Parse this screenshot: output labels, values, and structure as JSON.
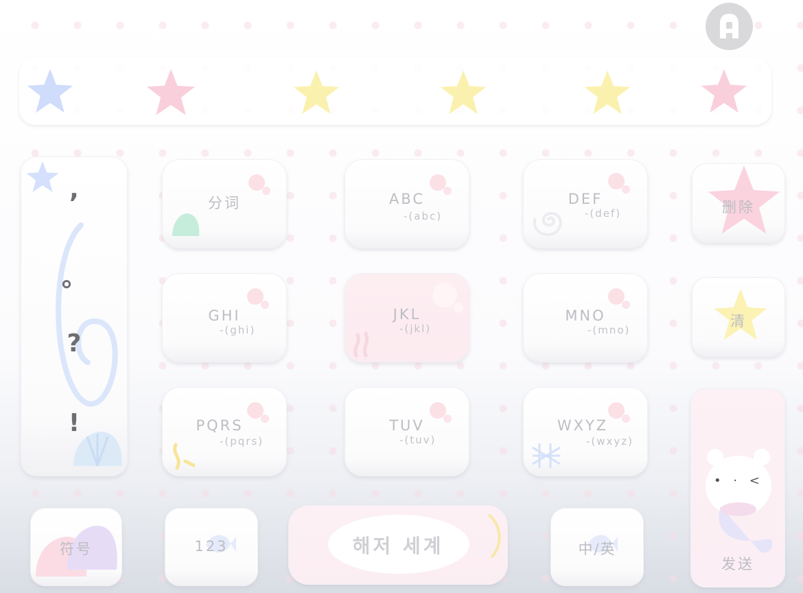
{
  "colors": {
    "dot_pink": "#f6dce4",
    "star_blue": "#c9d8fb",
    "star_pink": "#f9c9d6",
    "star_yellow": "#fbf1a9",
    "key_text": "#bdbdc3",
    "punct_text": "#6d6d72"
  },
  "top": {
    "avatar_icon": "user-icon",
    "candidate_bar_icons": [
      "blue-star-icon",
      "pink-star-icon",
      "yellow-star-icon",
      "yellow-star-icon",
      "yellow-star-icon",
      "pink-star-icon"
    ]
  },
  "punctuation": [
    ",",
    "。",
    "?",
    "!"
  ],
  "keys": {
    "segment": "分词",
    "abc_main": "ABC",
    "abc_sub": "-(abc)",
    "def_main": "DEF",
    "def_sub": "-(def)",
    "ghi_main": "GHI",
    "ghi_sub": "-(ghi)",
    "jkl_main": "JKL",
    "jkl_sub": "-(jkl)",
    "mno_main": "MNO",
    "mno_sub": "-(mno)",
    "pqrs_main": "PQRS",
    "pqrs_sub": "-(pqrs)",
    "tuv_main": "TUV",
    "tuv_sub": "-(tuv)",
    "wxyz_main": "WXYZ",
    "wxyz_sub": "-(wxyz)",
    "delete": "删除",
    "clear": "清",
    "send": "发送",
    "symbols": "符号",
    "numbers": "123",
    "space": "해저 세계",
    "lang_switch": "中/英"
  },
  "mascot_face": "• · <"
}
